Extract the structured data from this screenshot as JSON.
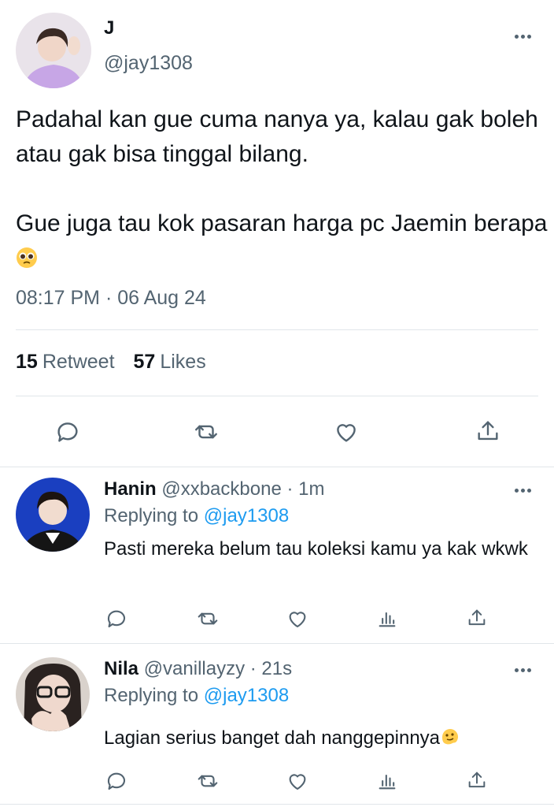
{
  "tweet": {
    "name": "J",
    "handle": "@jay1308",
    "text_line1": "Padahal kan gue cuma nanya ya, kalau gak boleh atau gak bisa tinggal bilang.",
    "text_line2": "Gue juga tau kok pasaran harga pc Jaemin berapa",
    "timestamp": "08:17 PM · 06 Aug 24",
    "retweet_count": "15",
    "retweet_label": "Retweet",
    "likes_count": "57",
    "likes_label": "Likes",
    "action_icons": [
      "reply-icon",
      "retweet-icon",
      "like-icon",
      "share-icon"
    ]
  },
  "replies": [
    {
      "name": "Hanin",
      "handle": "@xxbackbone · 1m",
      "replying_prefix": "Replying to",
      "replying_to": "@jay1308",
      "text": "Pasti mereka belum tau koleksi kamu ya kak wkwk",
      "action_icons": [
        "reply-icon",
        "retweet-icon",
        "like-icon",
        "views-icon",
        "share-icon"
      ]
    },
    {
      "name": "Nila",
      "handle": "@vanillayzy · 21s",
      "replying_prefix": "Replying to",
      "replying_to": "@jay1308",
      "text": "Lagian serius banget dah nanggepinnya",
      "action_icons": [
        "reply-icon",
        "retweet-icon",
        "like-icon",
        "views-icon",
        "share-icon"
      ]
    }
  ],
  "colors": {
    "text": "#0f1419",
    "secondary": "#536471",
    "link": "#1d9bf0",
    "divider": "#e1e6ea"
  }
}
